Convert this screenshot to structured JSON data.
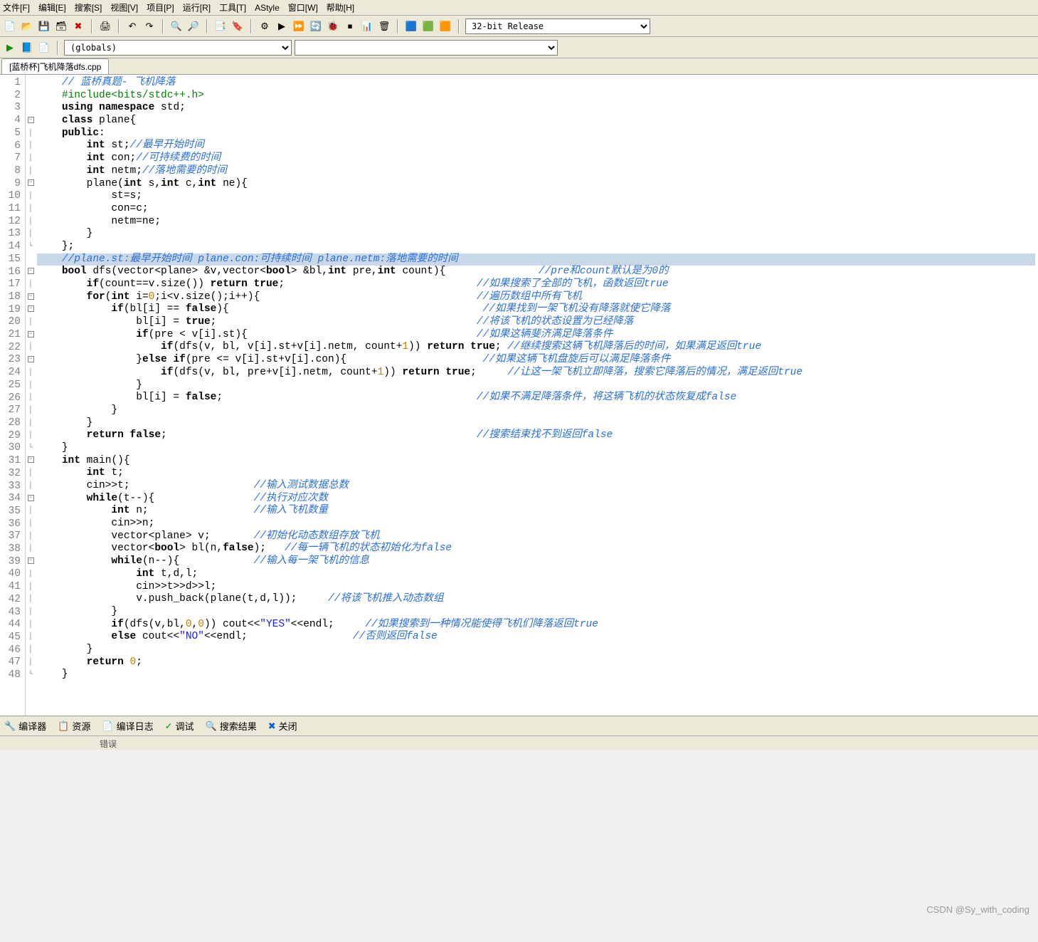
{
  "menu": {
    "file": "文件[F]",
    "edit": "编辑[E]",
    "search": "搜索[S]",
    "view": "视图[V]",
    "project": "项目[P]",
    "run": "运行[R]",
    "tools": "工具[T]",
    "astyle": "AStyle",
    "window": "窗口[W]",
    "help": "帮助[H]"
  },
  "toolbar_icons": {
    "new": "📄",
    "open": "📂",
    "save": "💾",
    "saveall": "🗃",
    "close": "✖",
    "print": "🖨",
    "undo": "↶",
    "redo": "↷",
    "find": "🔍",
    "findnext": "🔎",
    "goto": "📑",
    "bookmark": "🔖",
    "compile": "⚙",
    "run_btn": "▶",
    "compilerun": "⏩",
    "rebuild": "🔄",
    "debug": "🐞",
    "stop": "⏹",
    "profiler": "📊",
    "deleteexe": "🗑",
    "cfg1": "🟦",
    "cfg2": "🟩",
    "cfg3": "🟧"
  },
  "toolbar2_icons": {
    "run": "▶",
    "book": "📘",
    "new2": "📄"
  },
  "combos": {
    "globals": "(globals)",
    "blank": "",
    "config": "32-bit Release"
  },
  "tab_title": "[蓝桥杯]飞机降落dfs.cpp",
  "code_lines": [
    {
      "n": 1,
      "f": "",
      "segs": [
        [
          "    ",
          ""
        ],
        [
          "// 蓝桥真题- 飞机降落",
          "cm"
        ]
      ]
    },
    {
      "n": 2,
      "f": "",
      "segs": [
        [
          "    ",
          ""
        ],
        [
          "#include<bits/stdc++.h>",
          "pp"
        ]
      ]
    },
    {
      "n": 3,
      "f": "",
      "segs": [
        [
          "    ",
          ""
        ],
        [
          "using namespace ",
          "kw"
        ],
        [
          "std;",
          ""
        ]
      ]
    },
    {
      "n": 4,
      "f": "⊟",
      "segs": [
        [
          "    ",
          ""
        ],
        [
          "class ",
          "kw"
        ],
        [
          "plane{",
          ""
        ]
      ]
    },
    {
      "n": 5,
      "f": "│",
      "segs": [
        [
          "    ",
          ""
        ],
        [
          "public",
          "kw"
        ],
        [
          ":",
          ""
        ]
      ]
    },
    {
      "n": 6,
      "f": "│",
      "segs": [
        [
          "        ",
          ""
        ],
        [
          "int ",
          "kw"
        ],
        [
          "st;",
          ""
        ],
        [
          "//最早开始时间",
          "cm"
        ]
      ]
    },
    {
      "n": 7,
      "f": "│",
      "segs": [
        [
          "        ",
          ""
        ],
        [
          "int ",
          "kw"
        ],
        [
          "con;",
          ""
        ],
        [
          "//可持续费的时间",
          "cm"
        ]
      ]
    },
    {
      "n": 8,
      "f": "│",
      "segs": [
        [
          "        ",
          ""
        ],
        [
          "int ",
          "kw"
        ],
        [
          "netm;",
          ""
        ],
        [
          "//落地需要的时间",
          "cm"
        ]
      ]
    },
    {
      "n": 9,
      "f": "⊟",
      "segs": [
        [
          "        ",
          ""
        ],
        [
          "plane(",
          ""
        ],
        [
          "int ",
          "kw"
        ],
        [
          "s,",
          ""
        ],
        [
          "int ",
          "kw"
        ],
        [
          "c,",
          ""
        ],
        [
          "int ",
          "kw"
        ],
        [
          "ne){",
          ""
        ]
      ]
    },
    {
      "n": 10,
      "f": "│",
      "segs": [
        [
          "            st=s;",
          ""
        ]
      ]
    },
    {
      "n": 11,
      "f": "│",
      "segs": [
        [
          "            con=c;",
          ""
        ]
      ]
    },
    {
      "n": 12,
      "f": "│",
      "segs": [
        [
          "            netm=ne;",
          ""
        ]
      ]
    },
    {
      "n": 13,
      "f": "│",
      "segs": [
        [
          "        }",
          ""
        ]
      ]
    },
    {
      "n": 14,
      "f": "└",
      "segs": [
        [
          "    };",
          ""
        ]
      ]
    },
    {
      "n": 15,
      "f": "",
      "hl": true,
      "segs": [
        [
          "    ",
          ""
        ],
        [
          "//plane.st:最早开始时间 plane.con:可持续时间 plane.netm:落地需要的时间",
          "cm"
        ]
      ]
    },
    {
      "n": 16,
      "f": "⊟",
      "segs": [
        [
          "    ",
          ""
        ],
        [
          "bool ",
          "kw"
        ],
        [
          "dfs(vector<plane> &v,vector<",
          ""
        ],
        [
          "bool",
          "kw"
        ],
        [
          "> &bl,",
          ""
        ],
        [
          "int ",
          "kw"
        ],
        [
          "pre,",
          ""
        ],
        [
          "int ",
          "kw"
        ],
        [
          "count){               ",
          ""
        ],
        [
          "//pre和count默认是为0的",
          "cm"
        ]
      ]
    },
    {
      "n": 17,
      "f": "│",
      "segs": [
        [
          "        ",
          ""
        ],
        [
          "if",
          "kw"
        ],
        [
          "(count==v.size()) ",
          ""
        ],
        [
          "return true",
          "kw"
        ],
        [
          ";                               ",
          ""
        ],
        [
          "//如果搜索了全部的飞机，函数返回true",
          "cm"
        ]
      ]
    },
    {
      "n": 18,
      "f": "⊟",
      "segs": [
        [
          "        ",
          ""
        ],
        [
          "for",
          "kw"
        ],
        [
          "(",
          ""
        ],
        [
          "int ",
          "kw"
        ],
        [
          "i=",
          ""
        ],
        [
          "0",
          "num"
        ],
        [
          ";i<v.size();i++){                                   ",
          ""
        ],
        [
          "//遍历数组中所有飞机",
          "cm"
        ]
      ]
    },
    {
      "n": 19,
      "f": "⊟",
      "segs": [
        [
          "            ",
          ""
        ],
        [
          "if",
          "kw"
        ],
        [
          "(bl[i] == ",
          ""
        ],
        [
          "false",
          "kw"
        ],
        [
          "){                                         ",
          ""
        ],
        [
          "//如果找到一架飞机没有降落就使它降落",
          "cm"
        ]
      ]
    },
    {
      "n": 20,
      "f": "│",
      "segs": [
        [
          "                bl[i] = ",
          ""
        ],
        [
          "true",
          "kw"
        ],
        [
          ";                                          ",
          ""
        ],
        [
          "//将该飞机的状态设置为已经降落",
          "cm"
        ]
      ]
    },
    {
      "n": 21,
      "f": "⊟",
      "segs": [
        [
          "                ",
          ""
        ],
        [
          "if",
          "kw"
        ],
        [
          "(pre < v[i].st){                                     ",
          ""
        ],
        [
          "//如果这辆斐济满足降落条件",
          "cm"
        ]
      ]
    },
    {
      "n": 22,
      "f": "│",
      "segs": [
        [
          "                    ",
          ""
        ],
        [
          "if",
          "kw"
        ],
        [
          "(dfs(v, bl, v[i].st+v[i].netm, count+",
          ""
        ],
        [
          "1",
          "num"
        ],
        [
          ")) ",
          ""
        ],
        [
          "return true",
          "kw"
        ],
        [
          "; ",
          ""
        ],
        [
          "//继续搜索这辆飞机降落后的时间，如果满足返回true",
          "cm"
        ]
      ]
    },
    {
      "n": 23,
      "f": "⊟",
      "segs": [
        [
          "                }",
          ""
        ],
        [
          "else if",
          "kw"
        ],
        [
          "(pre <= v[i].st+v[i].con){                      ",
          ""
        ],
        [
          "//如果这辆飞机盘旋后可以满足降落条件",
          "cm"
        ]
      ]
    },
    {
      "n": 24,
      "f": "│",
      "segs": [
        [
          "                    ",
          ""
        ],
        [
          "if",
          "kw"
        ],
        [
          "(dfs(v, bl, pre+v[i].netm, count+",
          ""
        ],
        [
          "1",
          "num"
        ],
        [
          ")) ",
          ""
        ],
        [
          "return true",
          "kw"
        ],
        [
          ";     ",
          ""
        ],
        [
          "//让这一架飞机立即降落，搜索它降落后的情况，满足返回true",
          "cm"
        ]
      ]
    },
    {
      "n": 25,
      "f": "│",
      "segs": [
        [
          "                }",
          ""
        ]
      ]
    },
    {
      "n": 26,
      "f": "│",
      "segs": [
        [
          "                bl[i] = ",
          ""
        ],
        [
          "false",
          "kw"
        ],
        [
          ";                                         ",
          ""
        ],
        [
          "//如果不满足降落条件，将这辆飞机的状态恢复成false",
          "cm"
        ]
      ]
    },
    {
      "n": 27,
      "f": "│",
      "segs": [
        [
          "            }",
          ""
        ]
      ]
    },
    {
      "n": 28,
      "f": "│",
      "segs": [
        [
          "        }",
          ""
        ]
      ]
    },
    {
      "n": 29,
      "f": "│",
      "segs": [
        [
          "        ",
          ""
        ],
        [
          "return false",
          "kw"
        ],
        [
          ";                                                  ",
          ""
        ],
        [
          "//搜索结束找不到返回false",
          "cm"
        ]
      ]
    },
    {
      "n": 30,
      "f": "└",
      "segs": [
        [
          "    }",
          ""
        ]
      ]
    },
    {
      "n": 31,
      "f": "⊟",
      "segs": [
        [
          "    ",
          ""
        ],
        [
          "int ",
          "kw"
        ],
        [
          "main(){",
          ""
        ]
      ]
    },
    {
      "n": 32,
      "f": "│",
      "segs": [
        [
          "        ",
          ""
        ],
        [
          "int ",
          "kw"
        ],
        [
          "t;",
          ""
        ]
      ]
    },
    {
      "n": 33,
      "f": "│",
      "segs": [
        [
          "        cin>>t;                    ",
          ""
        ],
        [
          "//输入测试数据总数",
          "cm"
        ]
      ]
    },
    {
      "n": 34,
      "f": "⊟",
      "segs": [
        [
          "        ",
          ""
        ],
        [
          "while",
          "kw"
        ],
        [
          "(t--){                ",
          ""
        ],
        [
          "//执行对应次数",
          "cm"
        ]
      ]
    },
    {
      "n": 35,
      "f": "│",
      "segs": [
        [
          "            ",
          ""
        ],
        [
          "int ",
          "kw"
        ],
        [
          "n;                 ",
          ""
        ],
        [
          "//输入飞机数量",
          "cm"
        ]
      ]
    },
    {
      "n": 36,
      "f": "│",
      "segs": [
        [
          "            cin>>n;",
          ""
        ]
      ]
    },
    {
      "n": 37,
      "f": "│",
      "segs": [
        [
          "            vector<plane> v;       ",
          ""
        ],
        [
          "//初始化动态数组存放飞机",
          "cm"
        ]
      ]
    },
    {
      "n": 38,
      "f": "│",
      "segs": [
        [
          "            vector<",
          ""
        ],
        [
          "bool",
          "kw"
        ],
        [
          "> bl(n,",
          ""
        ],
        [
          "false",
          "kw"
        ],
        [
          ");   ",
          ""
        ],
        [
          "//每一辆飞机的状态初始化为false",
          "cm"
        ]
      ]
    },
    {
      "n": 39,
      "f": "⊟",
      "segs": [
        [
          "            ",
          ""
        ],
        [
          "while",
          "kw"
        ],
        [
          "(n--){            ",
          ""
        ],
        [
          "//输入每一架飞机的信息",
          "cm"
        ]
      ]
    },
    {
      "n": 40,
      "f": "│",
      "segs": [
        [
          "                ",
          ""
        ],
        [
          "int ",
          "kw"
        ],
        [
          "t,d,l;",
          ""
        ]
      ]
    },
    {
      "n": 41,
      "f": "│",
      "segs": [
        [
          "                cin>>t>>d>>l;",
          ""
        ]
      ]
    },
    {
      "n": 42,
      "f": "│",
      "segs": [
        [
          "                v.push_back(plane(t,d,l));     ",
          ""
        ],
        [
          "//将该飞机推入动态数组",
          "cm"
        ]
      ]
    },
    {
      "n": 43,
      "f": "│",
      "segs": [
        [
          "            }",
          ""
        ]
      ]
    },
    {
      "n": 44,
      "f": "│",
      "segs": [
        [
          "            ",
          ""
        ],
        [
          "if",
          "kw"
        ],
        [
          "(dfs(v,bl,",
          ""
        ],
        [
          "0",
          "num"
        ],
        [
          ",",
          ""
        ],
        [
          "0",
          "num"
        ],
        [
          ")) cout<<",
          ""
        ],
        [
          "\"YES\"",
          "str"
        ],
        [
          "<<endl;     ",
          ""
        ],
        [
          "//如果搜索到一种情况能使得飞机们降落返回true",
          "cm"
        ]
      ]
    },
    {
      "n": 45,
      "f": "│",
      "segs": [
        [
          "            ",
          ""
        ],
        [
          "else ",
          "kw"
        ],
        [
          "cout<<",
          ""
        ],
        [
          "\"NO\"",
          "str"
        ],
        [
          "<<endl;                 ",
          ""
        ],
        [
          "//否则返回false",
          "cm"
        ]
      ]
    },
    {
      "n": 46,
      "f": "│",
      "segs": [
        [
          "        }",
          ""
        ]
      ]
    },
    {
      "n": 47,
      "f": "│",
      "segs": [
        [
          "        ",
          ""
        ],
        [
          "return ",
          "kw"
        ],
        [
          "0",
          "num"
        ],
        [
          ";",
          ""
        ]
      ]
    },
    {
      "n": 48,
      "f": "└",
      "segs": [
        [
          "    }",
          ""
        ]
      ]
    }
  ],
  "bottom_tabs": {
    "compiler": "编译器",
    "resources": "资源",
    "compile_log": "编译日志",
    "debug": "调试",
    "search_results": "搜索结果",
    "close": "关闭"
  },
  "bottom_icons": {
    "compiler": "🔧",
    "resources": "📋",
    "compile_log": "📄",
    "debug": "✓",
    "search_results": "🔍",
    "close": "✖"
  },
  "watermark": "CSDN @Sy_with_coding",
  "status": "错误"
}
